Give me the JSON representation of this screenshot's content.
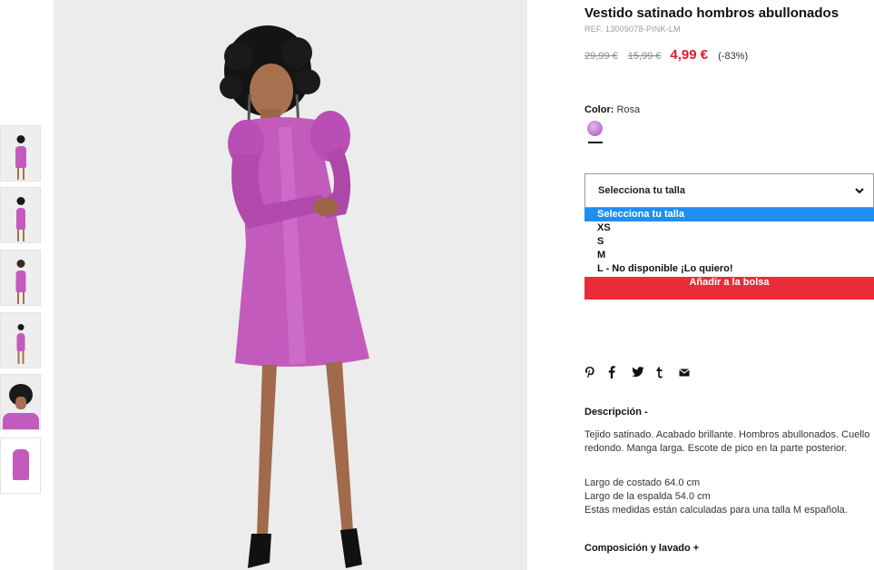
{
  "product": {
    "title": "Vestido satinado hombros abullonados",
    "ref": "REF. 13009078-PINK-LM",
    "price_original": "29,99 €",
    "price_previous": "15,99 €",
    "price_current": "4,99 €",
    "discount": "(-83%)"
  },
  "color": {
    "label": "Color:",
    "value": "Rosa",
    "swatch": "#c27ed3"
  },
  "size": {
    "select_label": "Selecciona tu talla",
    "options": [
      "Selecciona tu talla",
      "XS",
      "S",
      "M",
      "L - No disponible ¡Lo quiero!"
    ]
  },
  "actions": {
    "add_to_bag": "Añadir a la bolsa"
  },
  "social": [
    "pinterest-icon",
    "facebook-icon",
    "twitter-icon",
    "tumblr-icon",
    "email-icon"
  ],
  "description": {
    "title": "Descripción -",
    "text": "Tejido satinado. Acabado brillante. Hombros abullonados. Cuello redondo. Manga larga. Escote de pico en la parte posterior.",
    "measure_1": "Largo de costado 64.0 cm",
    "measure_2": "Largo de la espalda 54.0 cm",
    "measure_note": "Estas medidas están calculadas para una talla M española."
  },
  "composition": {
    "title": "Composición y lavado +"
  },
  "colors": {
    "accent_price": "#e4182a",
    "button_bg": "#ea2c3a",
    "option_highlight": "#1f8ef1",
    "dress": "#c35bbd"
  }
}
